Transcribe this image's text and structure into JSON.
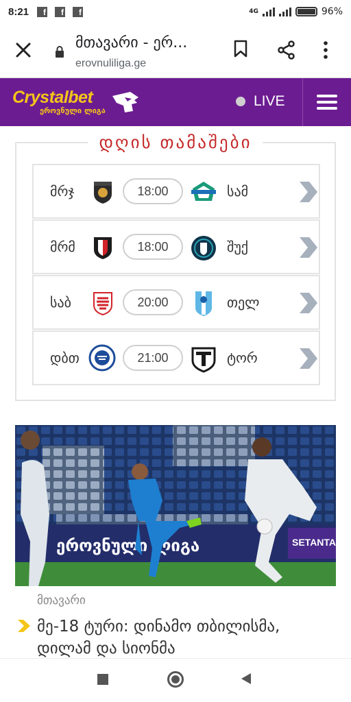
{
  "status_bar": {
    "time": "8:21",
    "network": "4G",
    "battery": "96%"
  },
  "browser": {
    "page_title": "მთავარი - ერ...",
    "host": "erovnuliliga.ge"
  },
  "site": {
    "brand": "Crystalbet",
    "brand_sub": "ეროვნული ლიგა",
    "live_label": "LIVE",
    "colors": {
      "header": "#6c1c91",
      "brand_yellow": "#f5c518",
      "title_red": "#c52a2a"
    }
  },
  "games": {
    "title": "დღის თამაშები",
    "matches": [
      {
        "home": "მრჯ",
        "time": "18:00",
        "away": "სამ"
      },
      {
        "home": "მრმ",
        "time": "18:00",
        "away": "შუქ"
      },
      {
        "home": "საბ",
        "time": "20:00",
        "away": "თელ"
      },
      {
        "home": "დბთ",
        "time": "21:00",
        "away": "ტორ"
      }
    ]
  },
  "news": {
    "banner_text": "ეროვნული ლიგა",
    "sponsor_text": "SETANTA SPORTS",
    "category": "მთავარი",
    "headline": "მე-18 ტური: დინამო თბილისმა, დილამ და სიონმა"
  }
}
